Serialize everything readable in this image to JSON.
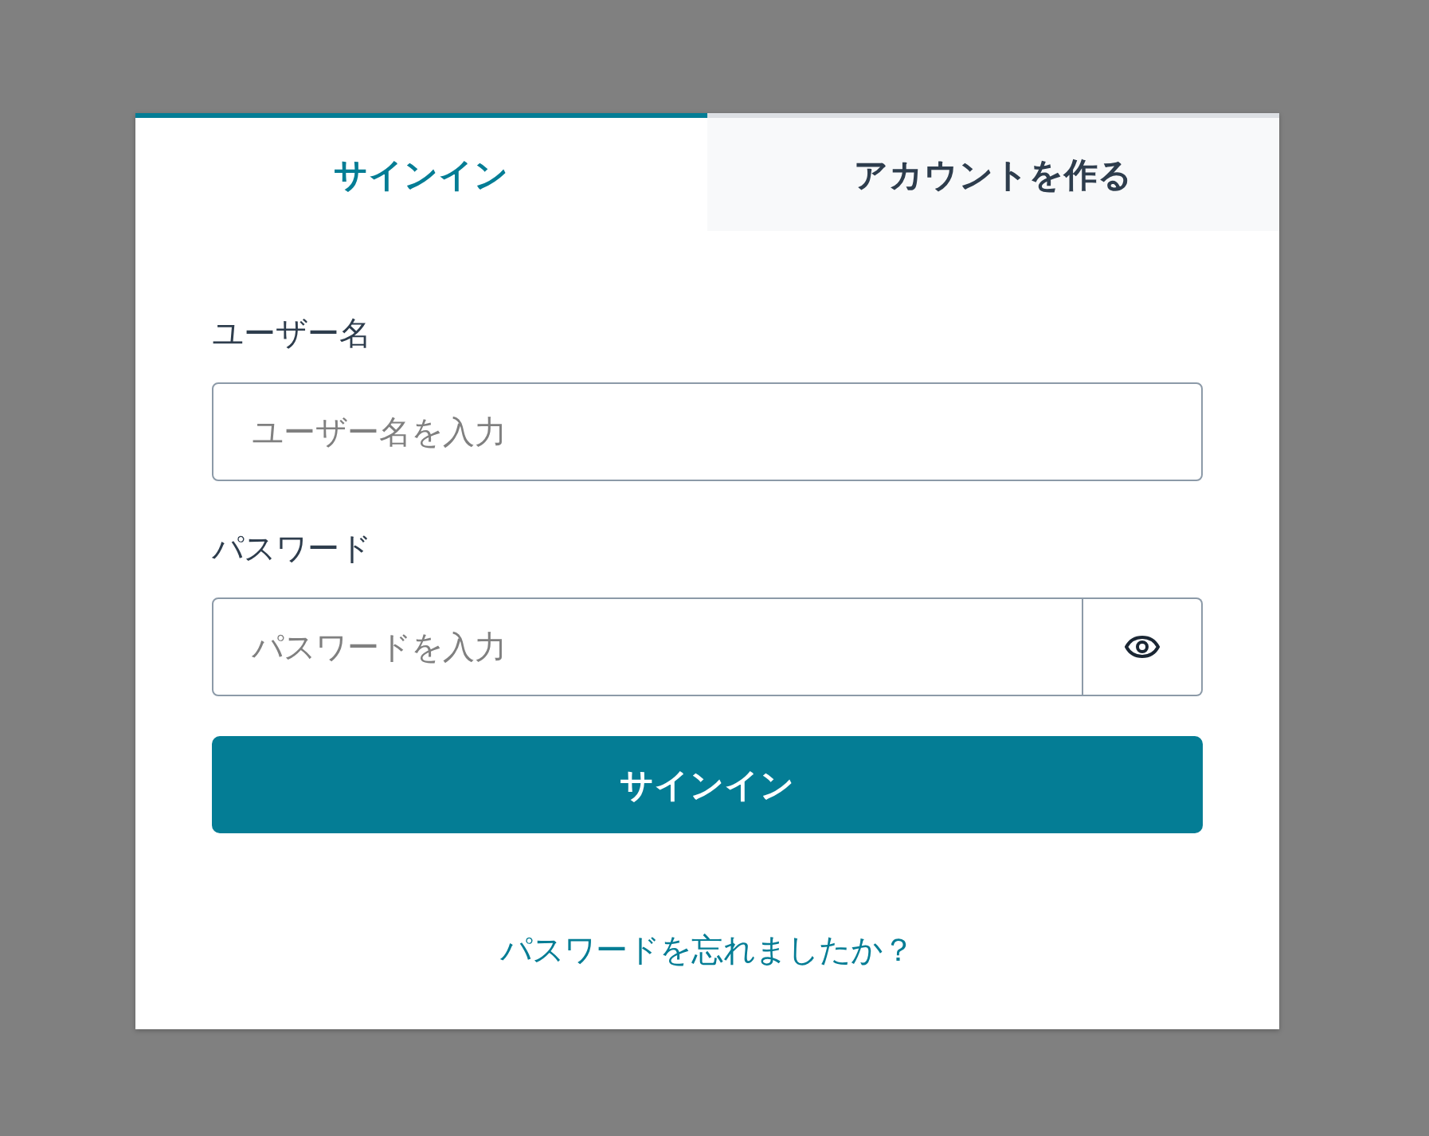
{
  "tabs": [
    {
      "label": "サインイン",
      "selected": true
    },
    {
      "label": "アカウントを作る",
      "selected": false
    }
  ],
  "form": {
    "fields": [
      {
        "kind": "text",
        "label": "ユーザー名",
        "placeholder": "ユーザー名を入力"
      },
      {
        "kind": "password",
        "label": "パスワード",
        "placeholder": "パスワードを入力"
      }
    ],
    "submit": "サインイン",
    "link": "パスワードを忘れましたか？"
  }
}
